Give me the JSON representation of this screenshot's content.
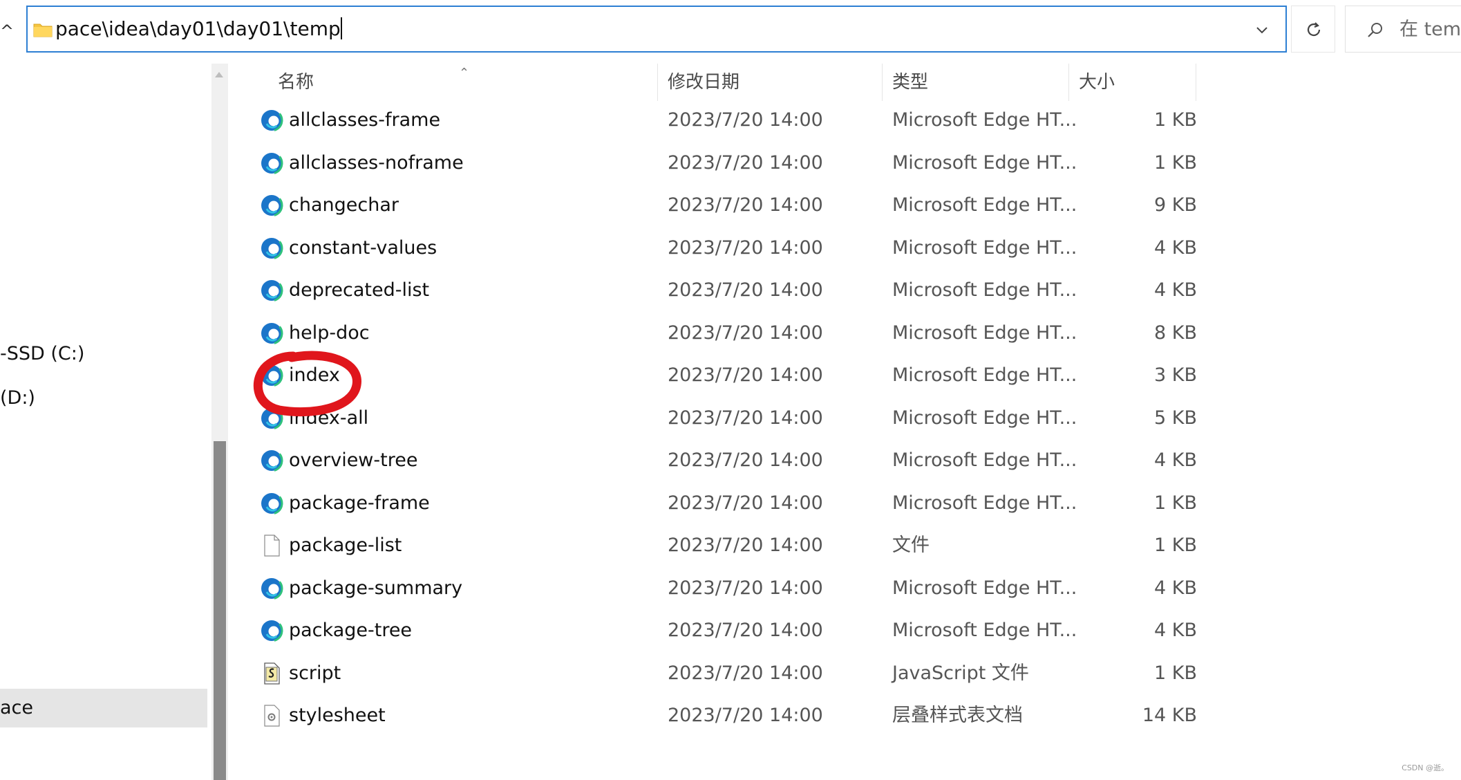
{
  "address_bar": {
    "path": "pace\\idea\\day01\\day01\\temp"
  },
  "search": {
    "placeholder": "在 temp"
  },
  "nav": {
    "items": [
      {
        "label": "-SSD (C:)"
      },
      {
        "label": "(D:)"
      },
      {
        "label": "ace"
      }
    ]
  },
  "columns": {
    "name": "名称",
    "date": "修改日期",
    "type": "类型",
    "size": "大小"
  },
  "files": [
    {
      "name": "allclasses-frame",
      "date": "2023/7/20 14:00",
      "type": "Microsoft Edge HT...",
      "size": "1 KB",
      "icon": "edge-icon"
    },
    {
      "name": "allclasses-noframe",
      "date": "2023/7/20 14:00",
      "type": "Microsoft Edge HT...",
      "size": "1 KB",
      "icon": "edge-icon"
    },
    {
      "name": "changechar",
      "date": "2023/7/20 14:00",
      "type": "Microsoft Edge HT...",
      "size": "9 KB",
      "icon": "edge-icon"
    },
    {
      "name": "constant-values",
      "date": "2023/7/20 14:00",
      "type": "Microsoft Edge HT...",
      "size": "4 KB",
      "icon": "edge-icon"
    },
    {
      "name": "deprecated-list",
      "date": "2023/7/20 14:00",
      "type": "Microsoft Edge HT...",
      "size": "4 KB",
      "icon": "edge-icon"
    },
    {
      "name": "help-doc",
      "date": "2023/7/20 14:00",
      "type": "Microsoft Edge HT...",
      "size": "8 KB",
      "icon": "edge-icon"
    },
    {
      "name": "index",
      "date": "2023/7/20 14:00",
      "type": "Microsoft Edge HT...",
      "size": "3 KB",
      "icon": "edge-icon"
    },
    {
      "name": "index-all",
      "date": "2023/7/20 14:00",
      "type": "Microsoft Edge HT...",
      "size": "5 KB",
      "icon": "edge-icon"
    },
    {
      "name": "overview-tree",
      "date": "2023/7/20 14:00",
      "type": "Microsoft Edge HT...",
      "size": "4 KB",
      "icon": "edge-icon"
    },
    {
      "name": "package-frame",
      "date": "2023/7/20 14:00",
      "type": "Microsoft Edge HT...",
      "size": "1 KB",
      "icon": "edge-icon"
    },
    {
      "name": "package-list",
      "date": "2023/7/20 14:00",
      "type": "文件",
      "size": "1 KB",
      "icon": "blank-file-icon"
    },
    {
      "name": "package-summary",
      "date": "2023/7/20 14:00",
      "type": "Microsoft Edge HT...",
      "size": "4 KB",
      "icon": "edge-icon"
    },
    {
      "name": "package-tree",
      "date": "2023/7/20 14:00",
      "type": "Microsoft Edge HT...",
      "size": "4 KB",
      "icon": "edge-icon"
    },
    {
      "name": "script",
      "date": "2023/7/20 14:00",
      "type": "JavaScript 文件",
      "size": "1 KB",
      "icon": "javascript-file-icon"
    },
    {
      "name": "stylesheet",
      "date": "2023/7/20 14:00",
      "type": "层叠样式表文档",
      "size": "14 KB",
      "icon": "css-file-icon"
    }
  ],
  "annotation": {
    "highlighted_file": "index",
    "color": "#e0161c"
  },
  "watermark": "CSDN @逝。"
}
